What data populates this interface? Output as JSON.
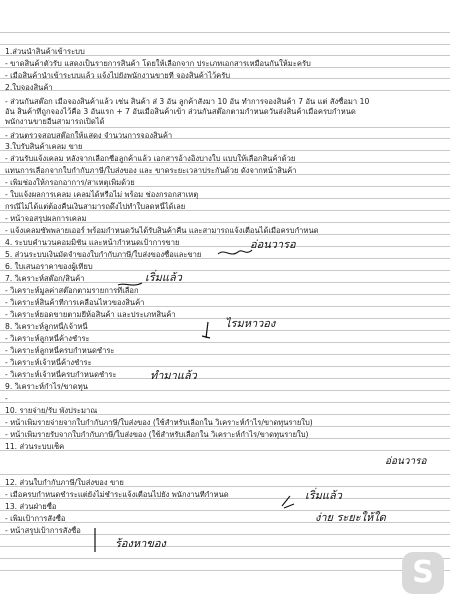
{
  "lines": [
    "1.ส่วนนำสินค้าเข้าระบบ",
    "- ขาดสินค้าตัวรับ แสดงเป็นรายการสินค้า โดยให้เลือกจาก ประเภทเอกสารเหมือนกันให้มะครับ",
    "- เมื่อสินค้านำเข้าระบบแล้ว แจ้งไปยังพนักงานขายที่ จองสินค้าไว้ครับ",
    "2.ใบจองสินค้า",
    "- ส่วนกันสต๊อก เมื่อจองสินค้าแล้ว เช่น สินค้า ส่ 3 อัน ลูกค้าสั่งมา 10 อัน ทำการจองสินค้า 7 อัน แต่ สั่งซื้อมา 10",
    "อัน สินค้าที่ถูกจองไว้คือ 3 อันแรก + 7 อันเมื่อสินค้าเข้า ส่วนกันสต๊อกตามกำหนดวันส่งสินค้าเมื่อครบกำหนด",
    "พนักงานขายอื่นสามารถเปิดได้",
    "- ส่วนตรวจสอบสต๊อกให้แสดง จำนวนการจองสินค้า",
    "3.ใบรับสินค้าเคลม ขาย",
    "- ส่วนรับแจ้งเคลม หลังจากเลือกชื่อลูกค้าแล้ว เอกสารอ้างอิงบางใบ แบบให้เลือกสินค้าด้วย",
    "แทนการเลือกจากใบกำกับภาษี/ใบส่งของ และ ขาดระยะเวลาประกันด้วย ดังจากหน้าสินค้า",
    "- เพิ่มช่องให้กรอกอาการ/สาเหตุเพิ่มด้วย",
    "- ใบแจ้งผลการเคลม เคลมได้หรือไม่ พร้อม ช่องกรอกสาเหตุ",
    "กรณีไม่ได้แต่ต้องคืนเงินสามารถดึงไปทำใบลดหนี้ได้เลย",
    "- หน้าจอสรุปผลการเคลม",
    "- แจ้งเคลมซัพพลายเออร์ พร้อมกำหนดวันได้รับสินค้าคืน และสามารถแจ้งเตือนได้เมื่อครบกำหนด",
    "4. ระบบคำนวนคอมมิชั่น และหน้ากำหนดเป้าการขาย",
    "5. ส่วนระบบเงินมัดจำของใบกำกับภาษี/ใบส่งของซื้อและขาย",
    "6. ใบเสนอราคาของผู้เทียบ",
    "7. วิเคราะห์สต๊อก/สินค้า",
    "- วิเคราะห์มูลค่าสต๊อกตามรายการที่เลือก",
    "- วิเคราะห์สินค้าที่การเคลื่อนไหวของสินค้า",
    "- วิเคราะห์ยอดขายตามยี่ห้อสินค้า และประเภทสินค้า",
    "8. วิเคราะห์ลูกหนี้/เจ้าหนี้",
    "- วิเคราะห์ลูกหนี้ค้างชำระ",
    "- วิเคราะห์ลูกหนี้ครบกำหนดชำระ",
    "- วิเคราะห์เจ้าหนี้ค้างชำระ",
    "- วิเคราะห์เจ้าหนี้ครบกำหนดชำระ",
    "9. วิเคราะห์กำไร/ขาดทุน",
    "-",
    "10. รายจ่าย/รับ พังประมาณ",
    "- หน้าเพิ่มรายจ่ายจากใบกำกับภาษี/ใบส่งของ (ใช้สำหรับเลือกใน วิเคราะห์กำไร/ขาดทุนรายใบ)",
    "- หน้าเพิ่มรายรับจากใบกำกับภาษี/ใบส่งของ (ใช้สำหรับเลือกใน วิเคราะห์กำไร/ขาดทุนรายใบ)",
    "11. ส่วนระบบเช็ค",
    "12. ส่วนใบกำกับภาษี/ใบส่งของ ขาย",
    "- เมื่อครบกำหนดชำระแต่ยังไม่ชำระแจ้งเตือนไปยัง พนักงานที่กำหนด",
    "13. ส่วนฝ่ายซื้อ",
    "- เพิ่มเป้าการสั่งซื้อ",
    "- หน้าสรุปเป้าการสั่งซื้อ"
  ],
  "handwriting": [
    "อ่อนวารอ",
    "เริ่มแล้ว",
    "ไรมหาวอง",
    "ทำมาแล้ว",
    "อ่อนวารอ",
    "เริ่มแล้ว",
    "ง่าย ระยะให้ใด",
    "ร้องหาของ"
  ],
  "watermark_letter": "S"
}
